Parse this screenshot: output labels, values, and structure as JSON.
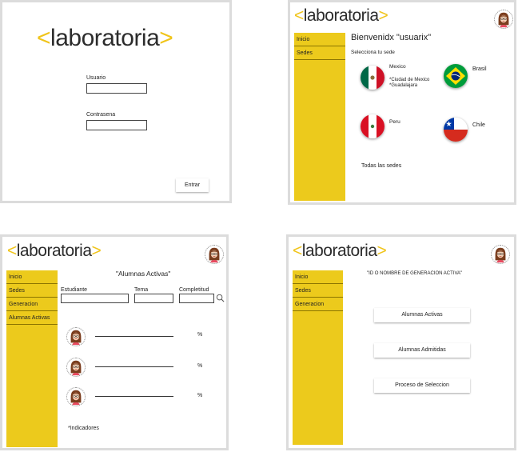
{
  "brand": {
    "name": "laboratoria",
    "open": "<",
    "close": ">",
    "accent": "#f0c419",
    "sidebar_color": "#ecca1c"
  },
  "login": {
    "user_label": "Usuario",
    "password_label": "Contrasena",
    "submit_label": "Entrar"
  },
  "sedes": {
    "greeting": "Bienvenidx \"usuarix\"",
    "prompt": "Selecciona tu sede",
    "nav": [
      "Inicio",
      "Sedes"
    ],
    "countries": [
      {
        "name": "Mexico",
        "cities": [
          "*Ciudad de Mexico",
          "*Guadalajara"
        ],
        "flag": "mexico-flag-icon"
      },
      {
        "name": "Brasil",
        "cities": [],
        "flag": "brazil-flag-icon"
      },
      {
        "name": "Peru",
        "cities": [],
        "flag": "peru-flag-icon"
      },
      {
        "name": "Chile",
        "cities": [],
        "flag": "chile-flag-icon"
      }
    ],
    "all": "Todas las sedes"
  },
  "activas": {
    "title": "\"Alumnas Activas\"",
    "nav": [
      "Inicio",
      "Sedes",
      "Generacion",
      "Alumnas Activas"
    ],
    "filters": {
      "student": "Estudiante",
      "topic": "Tema",
      "completeness": "Completitud"
    },
    "search_icon": "search-icon",
    "rows": [
      {
        "percent_label": "%"
      },
      {
        "percent_label": "%"
      },
      {
        "percent_label": "%"
      }
    ],
    "footer": "*Indicadores"
  },
  "generacion": {
    "title": "\"ID O NOMBRE DE GENERACION ACTIVA\"",
    "nav": [
      "Inicio",
      "Sedes",
      "Generacion"
    ],
    "buttons": [
      "Alumnas Activas",
      "Alumnas Admitidas",
      "Proceso de Seleccion"
    ]
  }
}
